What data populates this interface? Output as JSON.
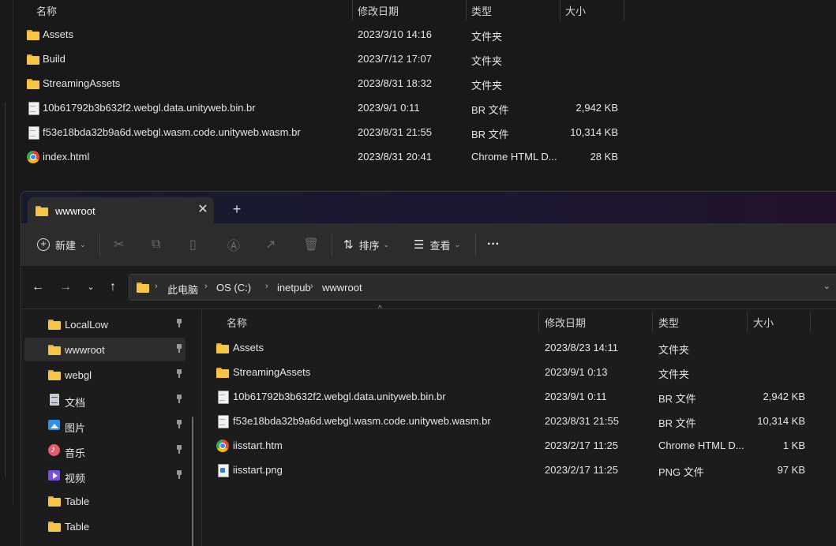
{
  "background_window": {
    "headers": {
      "name": "名称",
      "date": "修改日期",
      "type": "类型",
      "size": "大小"
    },
    "files": [
      {
        "name": "Assets",
        "date": "2023/3/10 14:16",
        "type": "文件夹",
        "size": "",
        "icon": "folder-icon"
      },
      {
        "name": "Build",
        "date": "2023/7/12 17:07",
        "type": "文件夹",
        "size": "",
        "icon": "folder-icon"
      },
      {
        "name": "StreamingAssets",
        "date": "2023/8/31 18:32",
        "type": "文件夹",
        "size": "",
        "icon": "folder-icon"
      },
      {
        "name": "10b61792b3b632f2.webgl.data.unityweb.bin.br",
        "date": "2023/9/1 0:11",
        "type": "BR 文件",
        "size": "2,942 KB",
        "icon": "file-icon"
      },
      {
        "name": "f53e18bda32b9a6d.webgl.wasm.code.unityweb.wasm.br",
        "date": "2023/8/31 21:55",
        "type": "BR 文件",
        "size": "10,314 KB",
        "icon": "file-icon"
      },
      {
        "name": "index.html",
        "date": "2023/8/31 20:41",
        "type": "Chrome HTML D...",
        "size": "28 KB",
        "icon": "chrome-icon"
      }
    ]
  },
  "window": {
    "tab_title": "wwwroot",
    "tab_close": "✕",
    "new_tab": "+",
    "toolbar": {
      "new_label": "新建",
      "sort_label": "排序",
      "view_label": "查看",
      "more": "···"
    },
    "address": {
      "crumbs": [
        "此电脑",
        "OS (C:)",
        "inetpub",
        "wwwroot"
      ]
    },
    "nav": [
      {
        "label": "LocalLow",
        "icon": "folder-icon",
        "pinned": true
      },
      {
        "label": "wwwroot",
        "icon": "folder-icon",
        "pinned": true,
        "selected": true
      },
      {
        "label": "webgl",
        "icon": "folder-icon",
        "pinned": true
      },
      {
        "label": "文档",
        "icon": "document-icon",
        "pinned": true
      },
      {
        "label": "图片",
        "icon": "pictures-icon",
        "pinned": true
      },
      {
        "label": "音乐",
        "icon": "music-icon",
        "pinned": true
      },
      {
        "label": "视频",
        "icon": "video-icon",
        "pinned": true
      },
      {
        "label": "Table",
        "icon": "folder-icon",
        "pinned": false
      },
      {
        "label": "Table",
        "icon": "folder-icon",
        "pinned": false
      }
    ],
    "headers": {
      "name": "名称",
      "date": "修改日期",
      "type": "类型",
      "size": "大小"
    },
    "files": [
      {
        "name": "Assets",
        "date": "2023/8/23 14:11",
        "type": "文件夹",
        "size": "",
        "icon": "folder-icon"
      },
      {
        "name": "StreamingAssets",
        "date": "2023/9/1 0:13",
        "type": "文件夹",
        "size": "",
        "icon": "folder-icon"
      },
      {
        "name": "10b61792b3b632f2.webgl.data.unityweb.bin.br",
        "date": "2023/9/1 0:11",
        "type": "BR 文件",
        "size": "2,942 KB",
        "icon": "file-icon"
      },
      {
        "name": "f53e18bda32b9a6d.webgl.wasm.code.unityweb.wasm.br",
        "date": "2023/8/31 21:55",
        "type": "BR 文件",
        "size": "10,314 KB",
        "icon": "file-icon"
      },
      {
        "name": "iisstart.htm",
        "date": "2023/2/17 11:25",
        "type": "Chrome HTML D...",
        "size": "1 KB",
        "icon": "chrome-icon"
      },
      {
        "name": "iisstart.png",
        "date": "2023/2/17 11:25",
        "type": "PNG 文件",
        "size": "97 KB",
        "icon": "png-icon"
      }
    ]
  }
}
